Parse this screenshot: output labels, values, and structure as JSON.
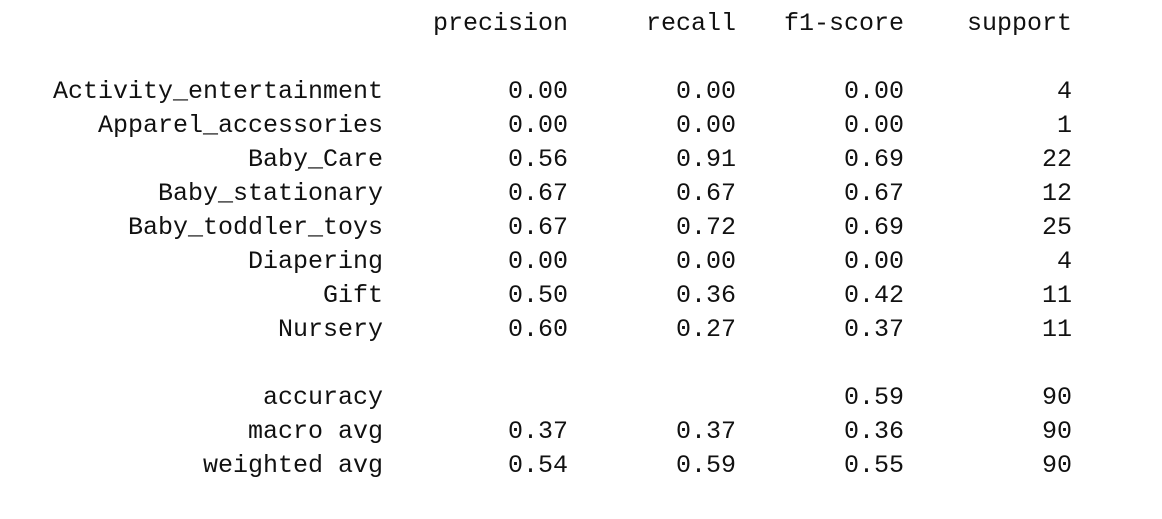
{
  "report": {
    "header": {
      "precision": "precision",
      "recall": "recall",
      "f1": "f1-score",
      "support": "support"
    },
    "classes": [
      {
        "label": "Activity_entertainment",
        "precision": "0.00",
        "recall": "0.00",
        "f1": "0.00",
        "support": "4"
      },
      {
        "label": "Apparel_accessories",
        "precision": "0.00",
        "recall": "0.00",
        "f1": "0.00",
        "support": "1"
      },
      {
        "label": "Baby_Care",
        "precision": "0.56",
        "recall": "0.91",
        "f1": "0.69",
        "support": "22"
      },
      {
        "label": "Baby_stationary",
        "precision": "0.67",
        "recall": "0.67",
        "f1": "0.67",
        "support": "12"
      },
      {
        "label": "Baby_toddler_toys",
        "precision": "0.67",
        "recall": "0.72",
        "f1": "0.69",
        "support": "25"
      },
      {
        "label": "Diapering",
        "precision": "0.00",
        "recall": "0.00",
        "f1": "0.00",
        "support": "4"
      },
      {
        "label": "Gift",
        "precision": "0.50",
        "recall": "0.36",
        "f1": "0.42",
        "support": "11"
      },
      {
        "label": "Nursery",
        "precision": "0.60",
        "recall": "0.27",
        "f1": "0.37",
        "support": "11"
      }
    ],
    "summary": [
      {
        "label": "accuracy",
        "precision": "",
        "recall": "",
        "f1": "0.59",
        "support": "90"
      },
      {
        "label": "macro avg",
        "precision": "0.37",
        "recall": "0.37",
        "f1": "0.36",
        "support": "90"
      },
      {
        "label": "weighted avg",
        "precision": "0.54",
        "recall": "0.59",
        "f1": "0.55",
        "support": "90"
      }
    ]
  }
}
